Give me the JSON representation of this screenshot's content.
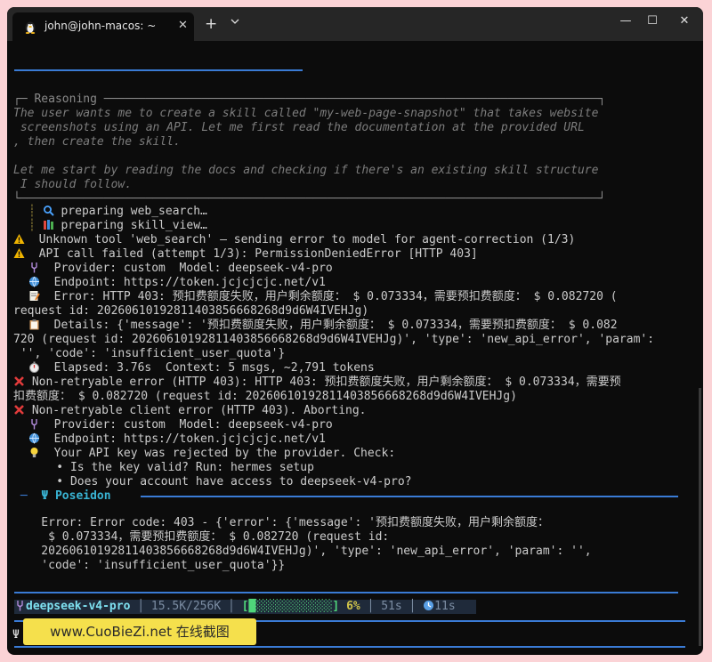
{
  "tab": {
    "title": "john@john-macos: ~",
    "close": "✕",
    "new": "+",
    "menu": "⌄"
  },
  "window_buttons": {
    "minimize": "—",
    "maximize": "☐",
    "close": "✕"
  },
  "reasoning": {
    "header": "┌─ Reasoning ───────────────────────────────────────────────────────────────────────┐",
    "lines": [
      "The user wants me to create a skill called \"my-web-page-snapshot\" that takes website",
      " screenshots using an API. Let me first read the documentation at the provided URL",
      ", then create the skill.",
      "",
      "Let me start by reading the docs and checking if there's an existing skill structure",
      " I should follow."
    ],
    "footer": "└───────────────────────────────────────────────────────────────────────────────────┘"
  },
  "tool_lines": [
    {
      "icon": "magnifier-icon",
      "text": "preparing web_search…"
    },
    {
      "icon": "books-icon",
      "text": "preparing skill_view…"
    }
  ],
  "log": {
    "warn1": "  Unknown tool 'web_search' — sending error to model for agent-correction (1/3)",
    "warn2": "  API call failed (attempt 1/3): PermissionDeniedError [HTTP 403]",
    "provider1": "  Provider: custom  Model: deepseek-v4-pro",
    "endpoint1": "  Endpoint: https://token.jcjcjcjc.net/v1",
    "error1": "  Error: HTTP 403: 预扣费额度失败，用户剩余额度： $ 0.073334，需要预扣费额度： $ 0.082720 (",
    "error1b": "request id: 20260610192811403856668268d9d6W4IVEHJg)",
    "details1": "  Details: {'message': '预扣费额度失败，用户剩余额度： $ 0.073334，需要预扣费额度： $ 0.082",
    "details1b": "720 (request id: 20260610192811403856668268d9d6W4IVEHJg)', 'type': 'new_api_error', 'param':",
    "details1c": " '', 'code': 'insufficient_user_quota'}",
    "elapsed": "  Elapsed: 3.76s  Context: 5 msgs, ~2,791 tokens",
    "nonretry1": " Non-retryable error (HTTP 403): HTTP 403: 预扣费额度失败，用户剩余额度： $ 0.073334，需要预",
    "nonretry1b": "扣费额度： $ 0.082720 (request id: 20260610192811403856668268d9d6W4IVEHJg)",
    "nonretry2": " Non-retryable client error (HTTP 403). Aborting.",
    "provider2": "  Provider: custom  Model: deepseek-v4-pro",
    "endpoint2": "  Endpoint: https://token.jcjcjcjc.net/v1",
    "hint": "  Your API key was rejected by the provider. Check:",
    "bullet1": "    • Is the key valid? Run: hermes setup",
    "bullet2": "    • Does your account have access to deepseek-v4-pro?"
  },
  "poseidon": {
    "prefix": " ─  ",
    "name": "Ψ Poseidon",
    "lines": [
      "    Error: Error code: 403 - {'error': {'message': '预扣费额度失败，用户剩余额度：",
      "     $ 0.073334，需要预扣费额度： $ 0.082720 (request id:",
      "    20260610192811403856668268d9d6W4IVEHJg)', 'type': 'new_api_error', 'param': '',",
      "    'code': 'insufficient_user_quota'}}"
    ]
  },
  "status_bar": {
    "model": "deepseek-v4-pro",
    "context": "15.5K/256K",
    "bar_open": "[",
    "bar_fill": "█░░░░░░░░░░░",
    "bar_close": "]",
    "progress_fraction": 0.06,
    "percent": "6%",
    "elapsed": "51s",
    "timer": "11s",
    "sep": " │ "
  },
  "prompt": "Ψ",
  "watermark": "www.CuoBieZi.net 在线截图",
  "colors": {
    "accent_line": "#3a7bd5",
    "poseidon": "#39b4d4",
    "error": "#e23b3b",
    "warning": "#f0b400"
  }
}
